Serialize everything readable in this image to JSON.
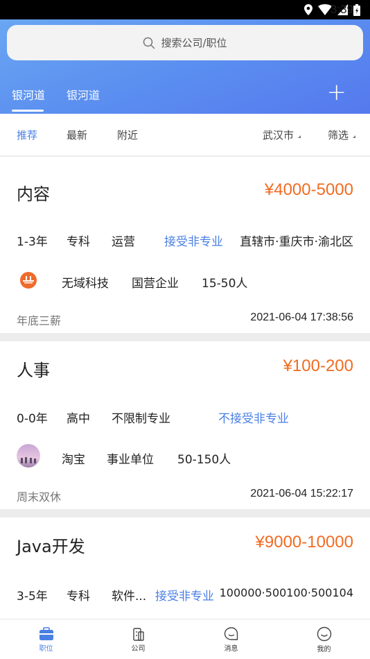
{
  "status_bar": {
    "time": "3:39"
  },
  "search": {
    "placeholder": "搜索公司/职位"
  },
  "tabs": [
    {
      "label": "银河道"
    },
    {
      "label": "银河道"
    }
  ],
  "filters": {
    "recommend": "推荐",
    "latest": "最新",
    "nearby": "附近",
    "city": "武汉市",
    "filter": "筛选"
  },
  "jobs": [
    {
      "title": "内容",
      "salary": "¥4000-5000",
      "req1": "1-3年",
      "req2": "专科",
      "req3": "运营",
      "major": "接受非专业",
      "location": "直辖市·重庆市·渝北区",
      "company": "无域科技",
      "company_type": "国营企业",
      "size": "15-50人",
      "benefit": "年底三薪",
      "time": "2021-06-04 17:38:56"
    },
    {
      "title": "人事",
      "salary": "¥100-200",
      "req1": "0-0年",
      "req2": "高中",
      "req3": "不限制专业",
      "major": "不接受非专业",
      "location": "",
      "company": "淘宝",
      "company_type": "事业单位",
      "size": "50-150人",
      "benefit": "周末双休",
      "time": "2021-06-04 15:22:17"
    },
    {
      "title": "Java开发",
      "salary": "¥9000-10000",
      "req1": "3-5年",
      "req2": "专科",
      "req3": "软件...",
      "major": "接受非专业",
      "location": "100000·500100·500104"
    }
  ],
  "nav": [
    {
      "label": "职位",
      "icon": "briefcase-icon"
    },
    {
      "label": "公司",
      "icon": "building-icon"
    },
    {
      "label": "消息",
      "icon": "chat-icon"
    },
    {
      "label": "我的",
      "icon": "smile-icon"
    }
  ],
  "colors": {
    "accent": "#4a7fe4",
    "salary": "#f26b22",
    "header_start": "#6aa6f2",
    "header_end": "#5579ee"
  }
}
